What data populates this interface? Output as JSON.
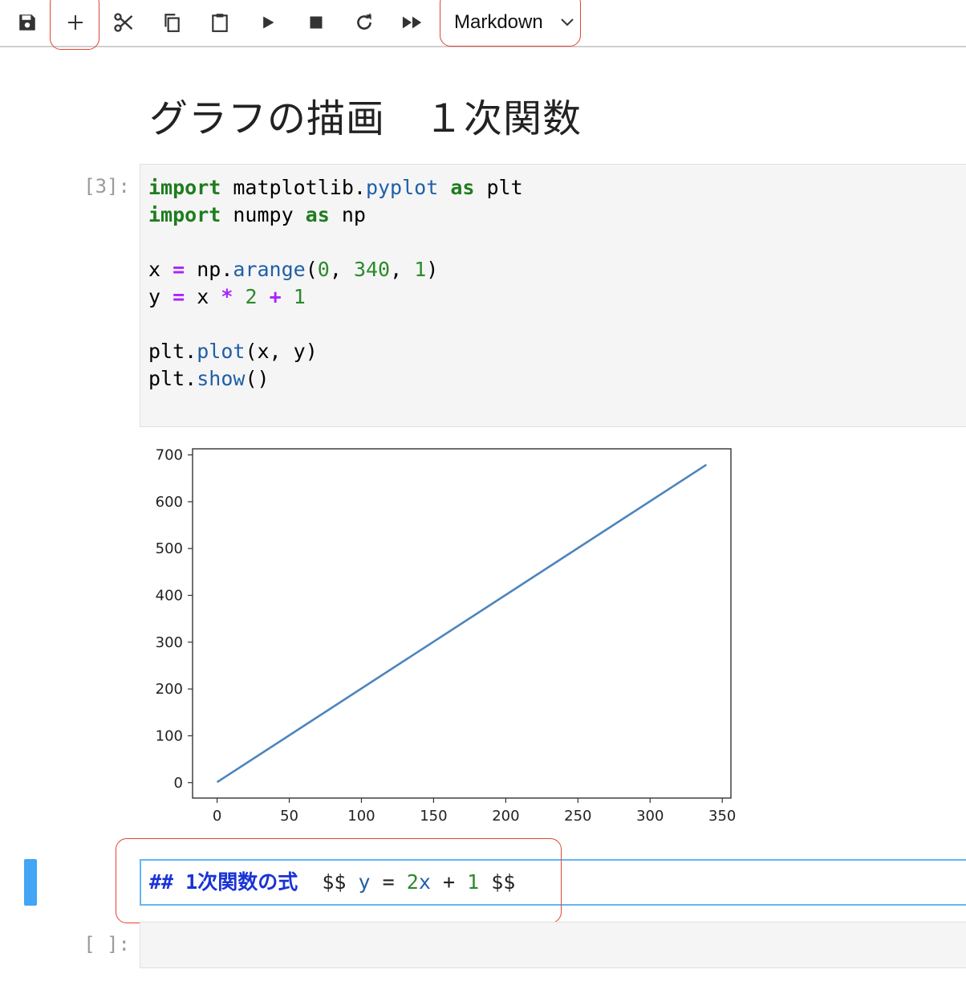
{
  "toolbar": {
    "buttons": [
      "save",
      "insert-cell",
      "cut",
      "copy",
      "paste",
      "run",
      "interrupt",
      "restart",
      "restart-run-all"
    ],
    "cell_type_selected": "Markdown"
  },
  "notebook": {
    "heading": "グラフの描画　１次関数",
    "code_cell": {
      "prompt": "[3]:",
      "lines": [
        "import matplotlib.pyplot as plt",
        "import numpy as np",
        "",
        "x = np.arange(0, 340, 1)",
        "y = x * 2 + 1",
        "",
        "plt.plot(x, y)",
        "plt.show()"
      ]
    },
    "markdown_cell": {
      "source": "## 1次関数の式  $$ y = 2x + 1 $$",
      "heading_marker": "##",
      "heading_text": "1次関数の式",
      "math_open": "$$",
      "math_y": "y",
      "math_eq": "=",
      "math_coef": "2",
      "math_var": "x",
      "math_plus": "+",
      "math_const": "1",
      "math_close": "$$"
    },
    "empty_cell": {
      "prompt": "[ ]:"
    }
  },
  "chart_data": {
    "type": "line",
    "x": [
      0,
      339
    ],
    "series": [
      {
        "values": [
          1,
          679
        ],
        "color": "#4d85bd"
      }
    ],
    "xlim": [
      -17,
      356
    ],
    "ylim": [
      -33,
      713
    ],
    "xticks": [
      0,
      50,
      100,
      150,
      200,
      250,
      300,
      350
    ],
    "yticks": [
      0,
      100,
      200,
      300,
      400,
      500,
      600,
      700
    ],
    "grid": false
  },
  "colors": {
    "highlight": "#e0452f",
    "active": "#42a5f5"
  }
}
